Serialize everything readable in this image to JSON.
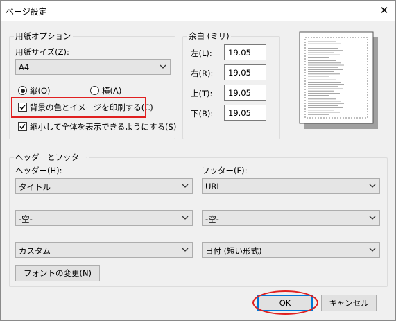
{
  "window": {
    "title": "ページ設定",
    "close_glyph": "✕"
  },
  "paper_options": {
    "legend": "用紙オプション",
    "size_label": "用紙サイズ(Z):",
    "size_value": "A4",
    "portrait_label": "縦(O)",
    "landscape_label": "横(A)",
    "orientation_selected": "portrait",
    "print_background_label": "背景の色とイメージを印刷する(C)",
    "print_background_checked": true,
    "shrink_label": "縮小して全体を表示できるようにする(S)",
    "shrink_checked": true
  },
  "margins": {
    "legend": "余白 (ミリ)",
    "left_label": "左(L):",
    "left_value": "19.05",
    "right_label": "右(R):",
    "right_value": "19.05",
    "top_label": "上(T):",
    "top_value": "19.05",
    "bottom_label": "下(B):",
    "bottom_value": "19.05"
  },
  "header_footer": {
    "legend": "ヘッダーとフッター",
    "header_label": "ヘッダー(H):",
    "footer_label": "フッター(F):",
    "header_values": [
      "タイトル",
      "-空-",
      "カスタム"
    ],
    "footer_values": [
      "URL",
      "-空-",
      "日付 (短い形式)"
    ],
    "font_button": "フォントの変更(N)"
  },
  "buttons": {
    "ok": "OK",
    "cancel": "キャンセル"
  },
  "colors": {
    "highlight": "#e02020",
    "ok_border": "#0078d7"
  },
  "icons": {
    "dropdown": "chevron-down-icon",
    "checkbox": "check-icon",
    "close": "close-icon"
  }
}
